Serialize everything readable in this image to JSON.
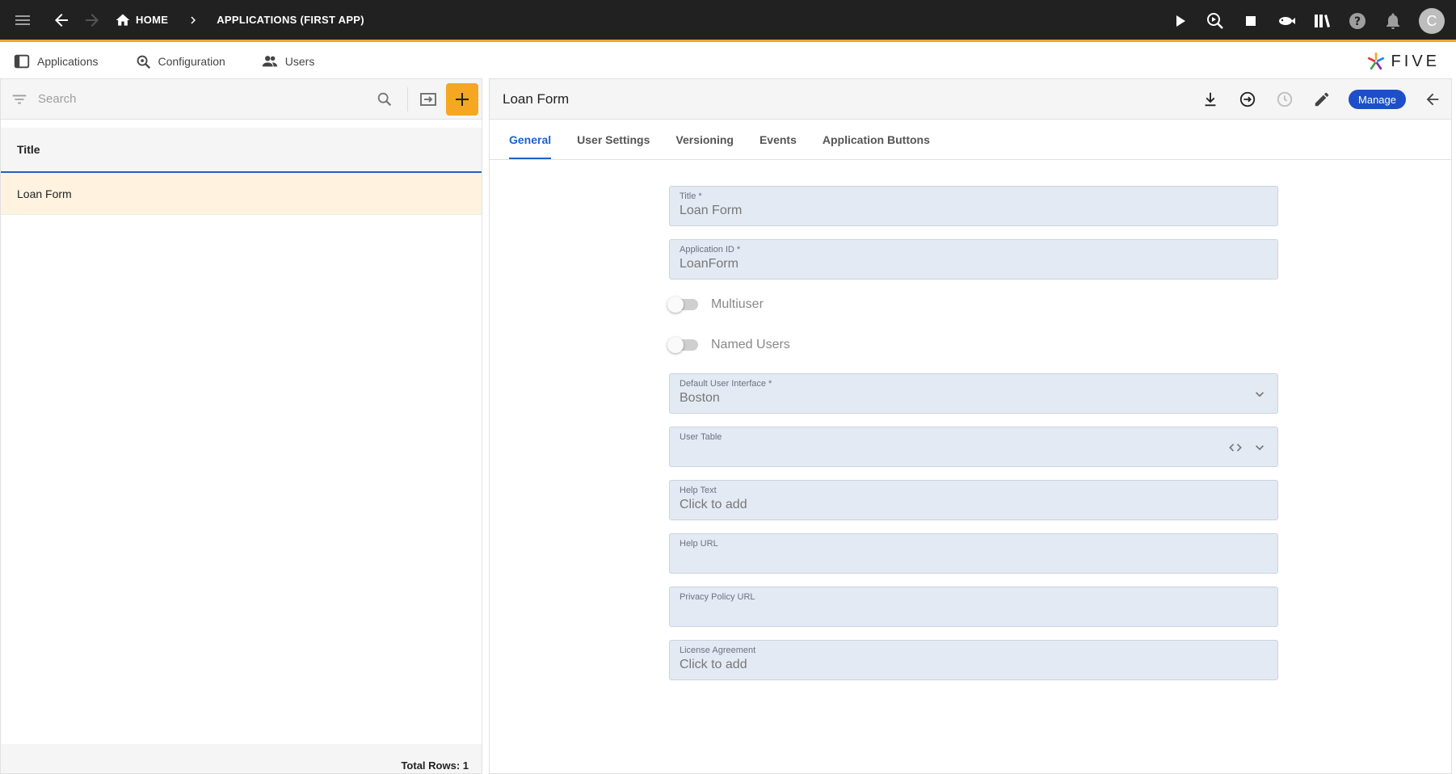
{
  "topbar": {
    "home_label": "HOME",
    "breadcrumb_label": "APPLICATIONS (FIRST APP)",
    "avatar_initial": "C",
    "accent_color": "#f5a623"
  },
  "menu": {
    "items": [
      {
        "label": "Applications",
        "icon": "applications-icon"
      },
      {
        "label": "Configuration",
        "icon": "configuration-icon"
      },
      {
        "label": "Users",
        "icon": "users-icon"
      }
    ],
    "logo_text": "FIVE"
  },
  "left": {
    "search_placeholder": "Search",
    "column_header": "Title",
    "rows": [
      {
        "title": "Loan Form"
      }
    ],
    "footer": "Total Rows: 1"
  },
  "right": {
    "title": "Loan Form",
    "manage_label": "Manage",
    "tabs": [
      "General",
      "User Settings",
      "Versioning",
      "Events",
      "Application Buttons"
    ],
    "active_tab": "General",
    "form": {
      "title": {
        "label": "Title *",
        "value": "Loan Form"
      },
      "app_id": {
        "label": "Application ID *",
        "value": "LoanForm"
      },
      "multiuser": {
        "label": "Multiuser",
        "on": false
      },
      "named_users": {
        "label": "Named Users",
        "on": false
      },
      "default_ui": {
        "label": "Default User Interface *",
        "value": "Boston"
      },
      "user_table": {
        "label": "User Table",
        "value": ""
      },
      "help_text": {
        "label": "Help Text",
        "value": "Click to add"
      },
      "help_url": {
        "label": "Help URL",
        "value": ""
      },
      "privacy_url": {
        "label": "Privacy Policy URL",
        "value": ""
      },
      "license": {
        "label": "License Agreement",
        "value": "Click to add"
      }
    }
  },
  "colors": {
    "primary": "#1e63c8",
    "manage_button": "#1e4fc8",
    "selected_row": "#fff3e0",
    "field_bg": "#e3eaf4"
  }
}
